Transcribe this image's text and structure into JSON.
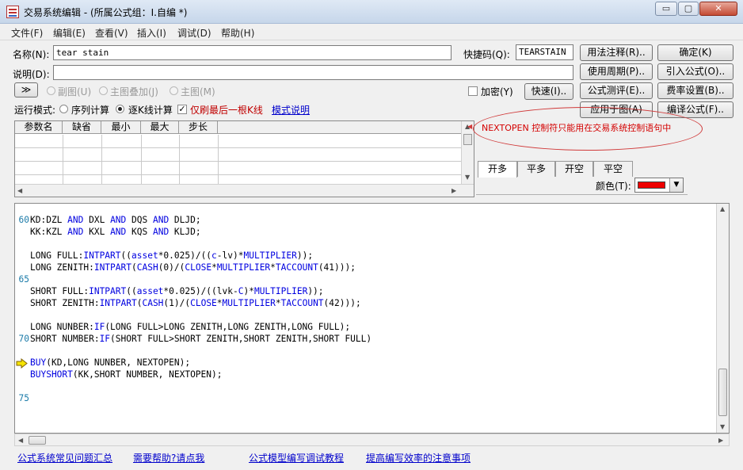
{
  "window": {
    "title": "交易系统编辑 - (所属公式组：I.自编 *)",
    "min_glyph": "▭",
    "max_glyph": "▢",
    "close_glyph": "✕"
  },
  "menu": [
    "文件(F)",
    "编辑(E)",
    "查看(V)",
    "插入(I)",
    "调试(D)",
    "帮助(H)"
  ],
  "form": {
    "name_label": "名称(N):",
    "name_value": "tear stain",
    "shortcut_label": "快捷码(Q):",
    "shortcut_value": "TEARSTAIN",
    "desc_label": "说明(D):",
    "desc_value": "",
    "expand_button": "≫",
    "chart_options": [
      "副图(U)",
      "主图叠加(J)",
      "主图(M)"
    ],
    "encrypt_label": "加密(Y)",
    "encrypt_checked": false,
    "run_mode_label": "运行模式:",
    "run_modes": [
      "序列计算",
      "逐K线计算"
    ],
    "run_mode_selected": "逐K线计算",
    "refresh_last_label": "仅刷最后一根K线",
    "refresh_last_checked": true,
    "mode_help_link": "模式说明"
  },
  "buttons": {
    "usage_notes": "用法注释(R)..",
    "confirm": "确定(K)",
    "use_period": "使用周期(P)..",
    "import_formula": "引入公式(O)..",
    "quick": "快速(I)..",
    "formula_test": "公式测评(E)..",
    "fee_settings": "费率设置(B)..",
    "apply_to_chart": "应用于图(A)",
    "compile_formula": "编译公式(F).."
  },
  "param_table": {
    "columns": [
      "参数名",
      "缺省",
      "最小",
      "最大",
      "步长"
    ],
    "rows": []
  },
  "annotation": "NEXTOPEN 控制符只能用在交易系统控制语句中",
  "signal_tabs": [
    "开多",
    "平多",
    "开空",
    "平空"
  ],
  "active_tab": "开多",
  "color_label": "颜色(T):",
  "colors": {
    "signal_color": "#ee0000",
    "annotation": "#d40000",
    "keyword": "#0000e0"
  },
  "code": [
    {
      "num": "60",
      "text": "KD:DZL AND DXL AND DQS AND DLJD;"
    },
    {
      "num": "",
      "text": "KK:KZL AND KXL AND KQS AND KLJD;"
    },
    {
      "num": "",
      "text": ""
    },
    {
      "num": "",
      "text": "LONG FULL:INTPART((asset*0.025)/((c-lv)*MULTIPLIER));"
    },
    {
      "num": "",
      "text": "LONG ZENITH:INTPART(CASH(0)/(CLOSE*MULTIPLIER*TACCOUNT(41)));"
    },
    {
      "num": "65",
      "text": ""
    },
    {
      "num": "",
      "text": "SHORT FULL:INTPART((asset*0.025)/((lvk-C)*MULTIPLIER));"
    },
    {
      "num": "",
      "text": "SHORT ZENITH:INTPART(CASH(1)/(CLOSE*MULTIPLIER*TACCOUNT(42)));"
    },
    {
      "num": "",
      "text": ""
    },
    {
      "num": "",
      "text": "LONG NUNBER:IF(LONG FULL>LONG ZENITH,LONG ZENITH,LONG FULL);"
    },
    {
      "num": "70",
      "text": "SHORT NUMBER:IF(SHORT FULL>SHORT ZENITH,SHORT ZENITH,SHORT FULL)"
    },
    {
      "num": "",
      "text": ""
    },
    {
      "num": "",
      "text": "BUY(KD,LONG NUNBER, NEXTOPEN);"
    },
    {
      "num": "",
      "text": "BUYSHORT(KK,SHORT NUMBER, NEXTOPEN);"
    },
    {
      "num": "",
      "text": ""
    },
    {
      "num": "75",
      "text": ""
    }
  ],
  "current_line_index": 12,
  "footer_links": [
    "公式系统常见问题汇总",
    "需要帮助?请点我",
    "公式模型编写调试教程",
    "提高编写效率的注意事项"
  ]
}
